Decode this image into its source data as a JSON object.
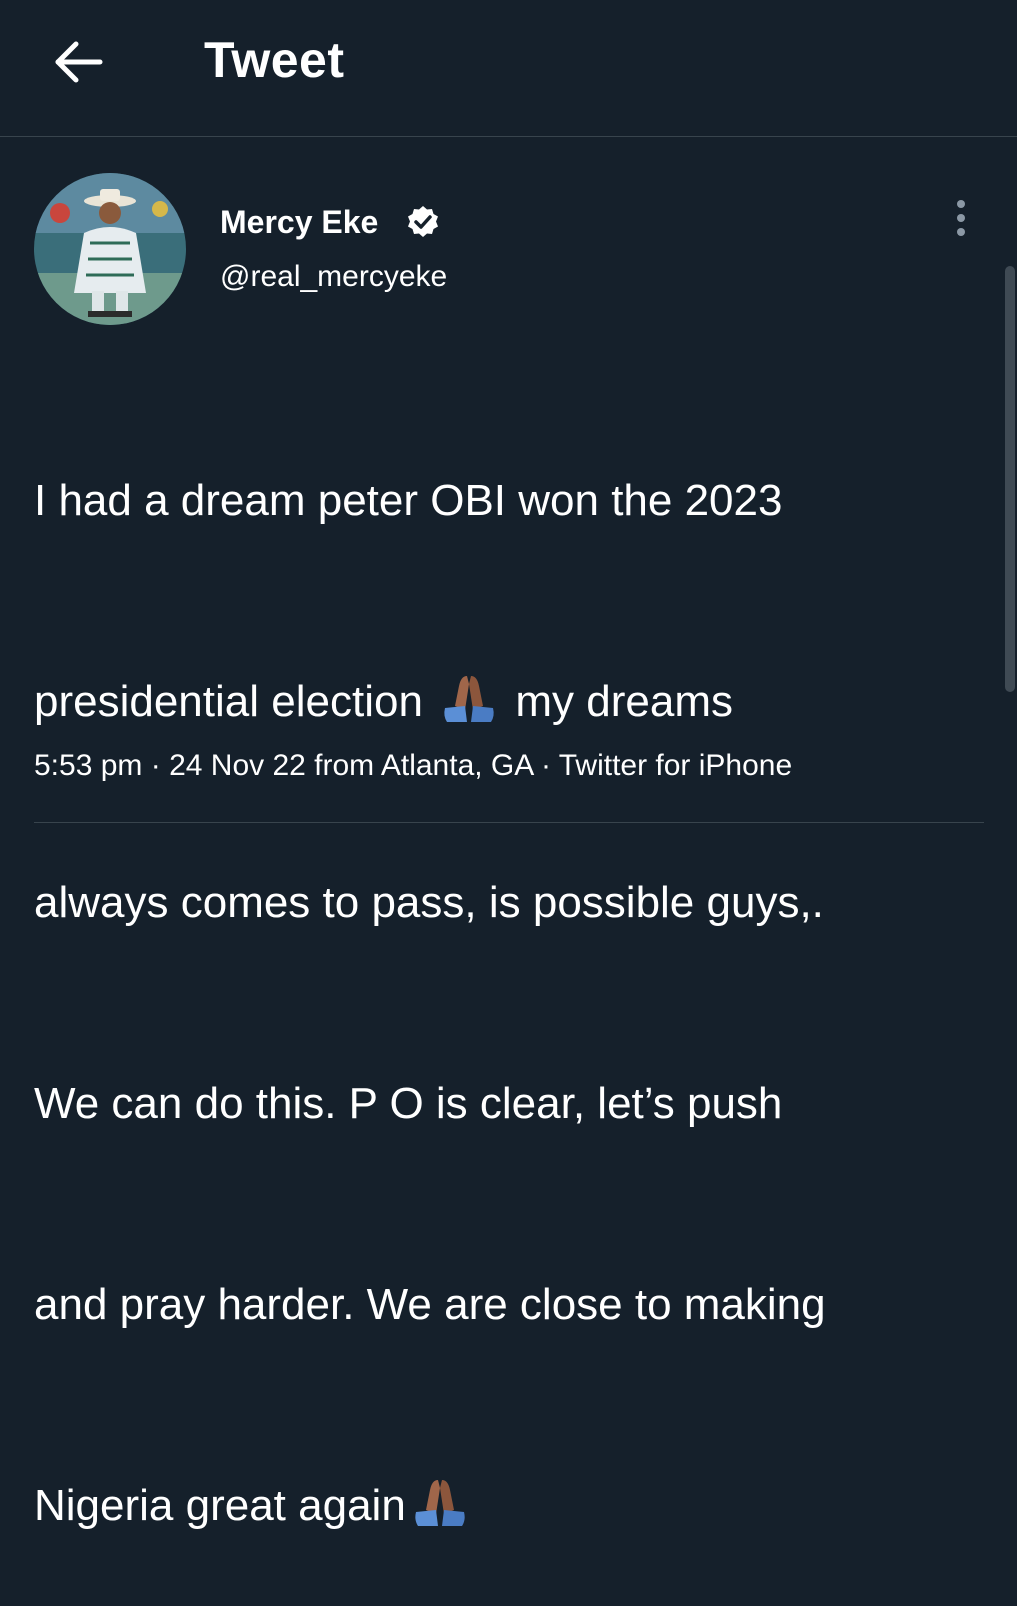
{
  "header": {
    "title": "Tweet",
    "back_icon": "arrow-left-icon"
  },
  "tweet": {
    "author": {
      "display_name": "Mercy Eke",
      "handle": "@real_mercyeke",
      "verified": true,
      "verified_icon": "verified-badge-icon"
    },
    "more_icon": "more-vertical-icon",
    "text_lines": [
      "I had a dream peter OBI  won the 2023",
      "presidential election",
      "my dreams",
      "always comes to pass, is possible guys,.",
      "We can do this. P O is clear, let’s push",
      "and pray harder. We are close to making",
      "Nigeria great again"
    ],
    "emoji_icon": "folded-hands-emoji",
    "meta": {
      "time": "5:53 pm",
      "separator": " · ",
      "date_location": "24 Nov 22 from Atlanta, GA",
      "client": "Twitter for iPhone"
    }
  },
  "colors": {
    "background": "#15202b",
    "text": "#ffffff",
    "divider": "#38444d",
    "muted": "#8b98a5"
  }
}
